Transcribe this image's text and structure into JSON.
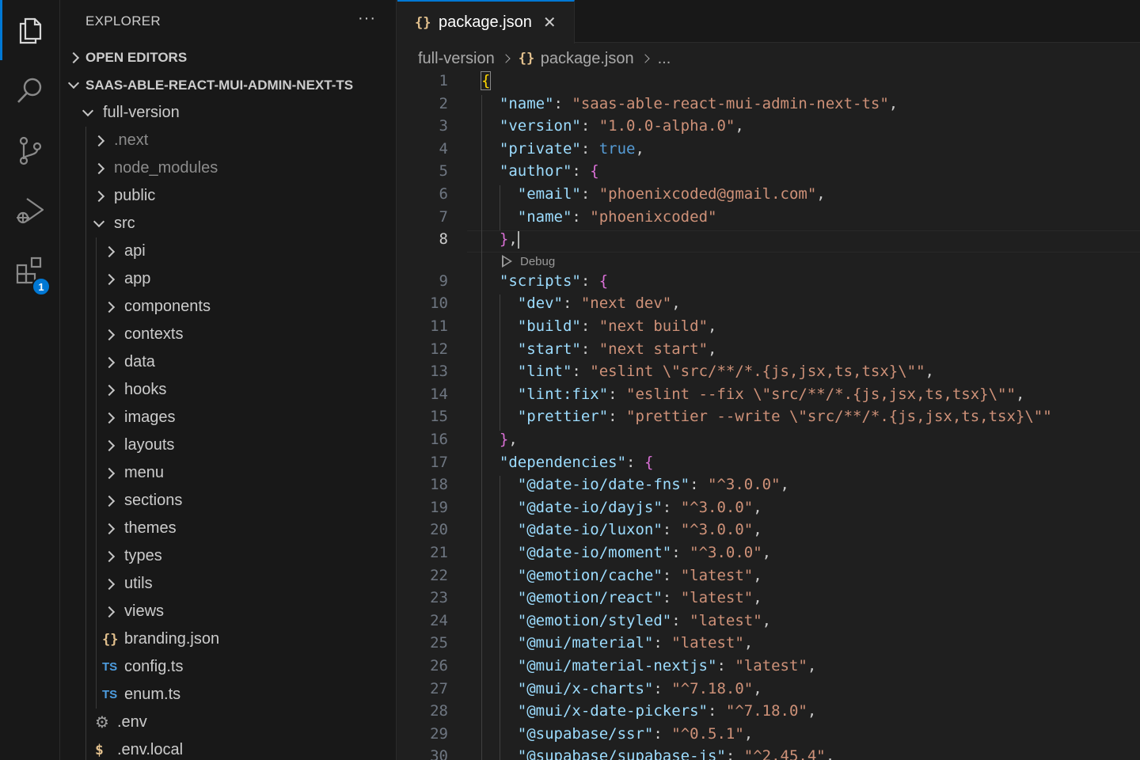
{
  "activity_bar": {
    "items": [
      {
        "name": "explorer",
        "icon": "files-icon",
        "active": true
      },
      {
        "name": "search",
        "icon": "search-icon"
      },
      {
        "name": "source-control",
        "icon": "source-control-icon"
      },
      {
        "name": "run-debug",
        "icon": "run-debug-icon"
      },
      {
        "name": "extensions",
        "icon": "extensions-icon",
        "badge": "1"
      }
    ]
  },
  "sidebar": {
    "title": "EXPLORER",
    "more": "···",
    "open_editors": "OPEN EDITORS",
    "project": "SAAS-ABLE-REACT-MUI-ADMIN-NEXT-TS",
    "tree": [
      {
        "label": "full-version",
        "type": "folder",
        "open": true,
        "depth": 0
      },
      {
        "label": ".next",
        "type": "folder",
        "open": false,
        "depth": 1,
        "dim": true
      },
      {
        "label": "node_modules",
        "type": "folder",
        "open": false,
        "depth": 1,
        "dim": true
      },
      {
        "label": "public",
        "type": "folder",
        "open": false,
        "depth": 1
      },
      {
        "label": "src",
        "type": "folder",
        "open": true,
        "depth": 1
      },
      {
        "label": "api",
        "type": "folder",
        "open": false,
        "depth": 2
      },
      {
        "label": "app",
        "type": "folder",
        "open": false,
        "depth": 2
      },
      {
        "label": "components",
        "type": "folder",
        "open": false,
        "depth": 2
      },
      {
        "label": "contexts",
        "type": "folder",
        "open": false,
        "depth": 2
      },
      {
        "label": "data",
        "type": "folder",
        "open": false,
        "depth": 2
      },
      {
        "label": "hooks",
        "type": "folder",
        "open": false,
        "depth": 2
      },
      {
        "label": "images",
        "type": "folder",
        "open": false,
        "depth": 2
      },
      {
        "label": "layouts",
        "type": "folder",
        "open": false,
        "depth": 2
      },
      {
        "label": "menu",
        "type": "folder",
        "open": false,
        "depth": 2
      },
      {
        "label": "sections",
        "type": "folder",
        "open": false,
        "depth": 2
      },
      {
        "label": "themes",
        "type": "folder",
        "open": false,
        "depth": 2
      },
      {
        "label": "types",
        "type": "folder",
        "open": false,
        "depth": 2
      },
      {
        "label": "utils",
        "type": "folder",
        "open": false,
        "depth": 2
      },
      {
        "label": "views",
        "type": "folder",
        "open": false,
        "depth": 2
      },
      {
        "label": "branding.json",
        "type": "json",
        "icon_text": "{}",
        "depth": 2
      },
      {
        "label": "config.ts",
        "type": "ts",
        "icon_text": "TS",
        "depth": 2
      },
      {
        "label": "enum.ts",
        "type": "ts",
        "icon_text": "TS",
        "depth": 2
      },
      {
        "label": ".env",
        "type": "env",
        "icon_text": "⚙",
        "depth": 1
      },
      {
        "label": ".env.local",
        "type": "dollar",
        "icon_text": "$",
        "depth": 1
      }
    ]
  },
  "editor": {
    "tab": {
      "icon_text": "{}",
      "label": "package.json",
      "close": "✕"
    },
    "breadcrumb": [
      "full-version",
      "package.json",
      "..."
    ],
    "breadcrumb_icon": "{}",
    "codelens": "Debug",
    "current_line": 8,
    "lines": [
      [
        {
          "t": "{",
          "c": "br1 br1box"
        }
      ],
      [
        {
          "t": "  "
        },
        {
          "t": "\"name\"",
          "c": "k"
        },
        {
          "t": ": "
        },
        {
          "t": "\"saas-able-react-mui-admin-next-ts\"",
          "c": "s"
        },
        {
          "t": ","
        }
      ],
      [
        {
          "t": "  "
        },
        {
          "t": "\"version\"",
          "c": "k"
        },
        {
          "t": ": "
        },
        {
          "t": "\"1.0.0-alpha.0\"",
          "c": "s"
        },
        {
          "t": ","
        }
      ],
      [
        {
          "t": "  "
        },
        {
          "t": "\"private\"",
          "c": "k"
        },
        {
          "t": ": "
        },
        {
          "t": "true",
          "c": "b"
        },
        {
          "t": ","
        }
      ],
      [
        {
          "t": "  "
        },
        {
          "t": "\"author\"",
          "c": "k"
        },
        {
          "t": ": "
        },
        {
          "t": "{",
          "c": "br2"
        }
      ],
      [
        {
          "t": "    "
        },
        {
          "t": "\"email\"",
          "c": "k"
        },
        {
          "t": ": "
        },
        {
          "t": "\"phoenixcoded@gmail.com\"",
          "c": "s"
        },
        {
          "t": ","
        }
      ],
      [
        {
          "t": "    "
        },
        {
          "t": "\"name\"",
          "c": "k"
        },
        {
          "t": ": "
        },
        {
          "t": "\"phoenixcoded\"",
          "c": "s"
        }
      ],
      [
        {
          "t": "  "
        },
        {
          "t": "}",
          "c": "br2"
        },
        {
          "t": ","
        }
      ],
      [
        {
          "t": "  "
        },
        {
          "t": "\"scripts\"",
          "c": "k"
        },
        {
          "t": ": "
        },
        {
          "t": "{",
          "c": "br2"
        }
      ],
      [
        {
          "t": "    "
        },
        {
          "t": "\"dev\"",
          "c": "k"
        },
        {
          "t": ": "
        },
        {
          "t": "\"next dev\"",
          "c": "s"
        },
        {
          "t": ","
        }
      ],
      [
        {
          "t": "    "
        },
        {
          "t": "\"build\"",
          "c": "k"
        },
        {
          "t": ": "
        },
        {
          "t": "\"next build\"",
          "c": "s"
        },
        {
          "t": ","
        }
      ],
      [
        {
          "t": "    "
        },
        {
          "t": "\"start\"",
          "c": "k"
        },
        {
          "t": ": "
        },
        {
          "t": "\"next start\"",
          "c": "s"
        },
        {
          "t": ","
        }
      ],
      [
        {
          "t": "    "
        },
        {
          "t": "\"lint\"",
          "c": "k"
        },
        {
          "t": ": "
        },
        {
          "t": "\"eslint \\\"src/**/*.{js,jsx,ts,tsx}\\\"\"",
          "c": "s"
        },
        {
          "t": ","
        }
      ],
      [
        {
          "t": "    "
        },
        {
          "t": "\"lint:fix\"",
          "c": "k"
        },
        {
          "t": ": "
        },
        {
          "t": "\"eslint --fix \\\"src/**/*.{js,jsx,ts,tsx}\\\"\"",
          "c": "s"
        },
        {
          "t": ","
        }
      ],
      [
        {
          "t": "    "
        },
        {
          "t": "\"prettier\"",
          "c": "k"
        },
        {
          "t": ": "
        },
        {
          "t": "\"prettier --write \\\"src/**/*.{js,jsx,ts,tsx}\\\"\"",
          "c": "s"
        }
      ],
      [
        {
          "t": "  "
        },
        {
          "t": "}",
          "c": "br2"
        },
        {
          "t": ","
        }
      ],
      [
        {
          "t": "  "
        },
        {
          "t": "\"dependencies\"",
          "c": "k"
        },
        {
          "t": ": "
        },
        {
          "t": "{",
          "c": "br2"
        }
      ],
      [
        {
          "t": "    "
        },
        {
          "t": "\"@date-io/date-fns\"",
          "c": "k"
        },
        {
          "t": ": "
        },
        {
          "t": "\"^3.0.0\"",
          "c": "s"
        },
        {
          "t": ","
        }
      ],
      [
        {
          "t": "    "
        },
        {
          "t": "\"@date-io/dayjs\"",
          "c": "k"
        },
        {
          "t": ": "
        },
        {
          "t": "\"^3.0.0\"",
          "c": "s"
        },
        {
          "t": ","
        }
      ],
      [
        {
          "t": "    "
        },
        {
          "t": "\"@date-io/luxon\"",
          "c": "k"
        },
        {
          "t": ": "
        },
        {
          "t": "\"^3.0.0\"",
          "c": "s"
        },
        {
          "t": ","
        }
      ],
      [
        {
          "t": "    "
        },
        {
          "t": "\"@date-io/moment\"",
          "c": "k"
        },
        {
          "t": ": "
        },
        {
          "t": "\"^3.0.0\"",
          "c": "s"
        },
        {
          "t": ","
        }
      ],
      [
        {
          "t": "    "
        },
        {
          "t": "\"@emotion/cache\"",
          "c": "k"
        },
        {
          "t": ": "
        },
        {
          "t": "\"latest\"",
          "c": "s"
        },
        {
          "t": ","
        }
      ],
      [
        {
          "t": "    "
        },
        {
          "t": "\"@emotion/react\"",
          "c": "k"
        },
        {
          "t": ": "
        },
        {
          "t": "\"latest\"",
          "c": "s"
        },
        {
          "t": ","
        }
      ],
      [
        {
          "t": "    "
        },
        {
          "t": "\"@emotion/styled\"",
          "c": "k"
        },
        {
          "t": ": "
        },
        {
          "t": "\"latest\"",
          "c": "s"
        },
        {
          "t": ","
        }
      ],
      [
        {
          "t": "    "
        },
        {
          "t": "\"@mui/material\"",
          "c": "k"
        },
        {
          "t": ": "
        },
        {
          "t": "\"latest\"",
          "c": "s"
        },
        {
          "t": ","
        }
      ],
      [
        {
          "t": "    "
        },
        {
          "t": "\"@mui/material-nextjs\"",
          "c": "k"
        },
        {
          "t": ": "
        },
        {
          "t": "\"latest\"",
          "c": "s"
        },
        {
          "t": ","
        }
      ],
      [
        {
          "t": "    "
        },
        {
          "t": "\"@mui/x-charts\"",
          "c": "k"
        },
        {
          "t": ": "
        },
        {
          "t": "\"^7.18.0\"",
          "c": "s"
        },
        {
          "t": ","
        }
      ],
      [
        {
          "t": "    "
        },
        {
          "t": "\"@mui/x-date-pickers\"",
          "c": "k"
        },
        {
          "t": ": "
        },
        {
          "t": "\"^7.18.0\"",
          "c": "s"
        },
        {
          "t": ","
        }
      ],
      [
        {
          "t": "    "
        },
        {
          "t": "\"@supabase/ssr\"",
          "c": "k"
        },
        {
          "t": ": "
        },
        {
          "t": "\"^0.5.1\"",
          "c": "s"
        },
        {
          "t": ","
        }
      ],
      [
        {
          "t": "    "
        },
        {
          "t": "\"@supabase/supabase-js\"",
          "c": "k"
        },
        {
          "t": ": "
        },
        {
          "t": "\"^2.45.4\"",
          "c": "s"
        },
        {
          "t": ","
        }
      ]
    ]
  }
}
